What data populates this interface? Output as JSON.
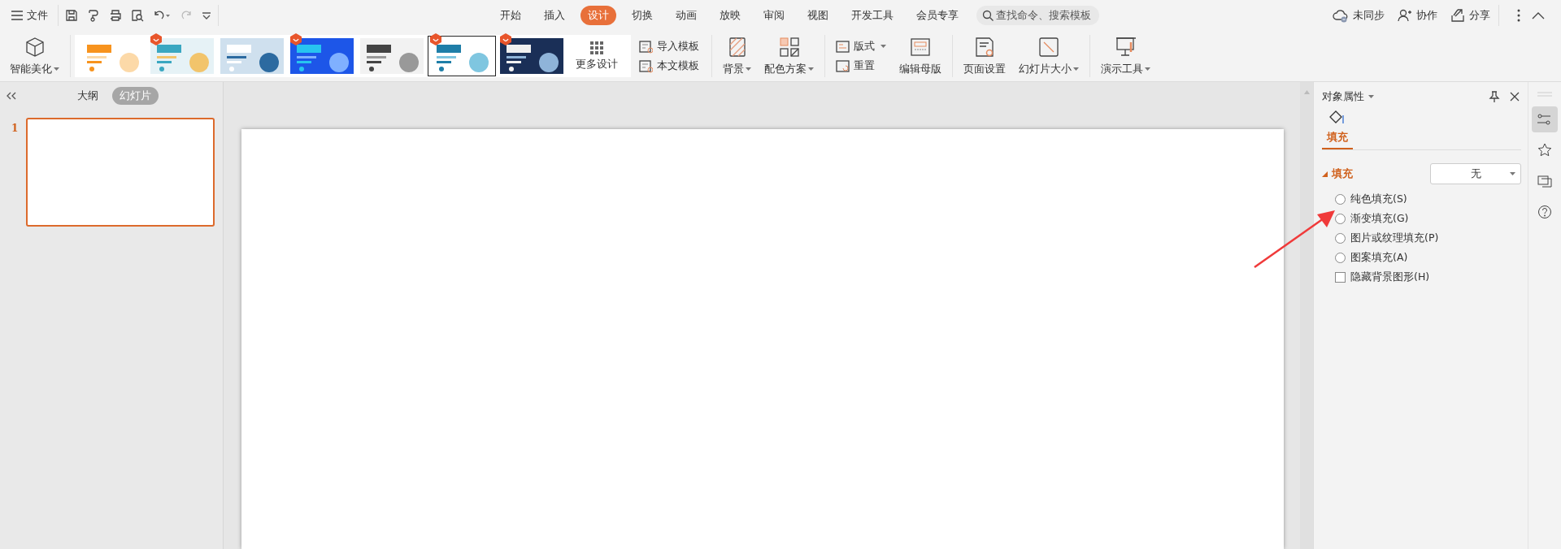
{
  "top_bar": {
    "file_menu": "文件",
    "tabs": [
      {
        "label": "开始",
        "selected": false
      },
      {
        "label": "插入",
        "selected": false
      },
      {
        "label": "设计",
        "selected": true
      },
      {
        "label": "切换",
        "selected": false
      },
      {
        "label": "动画",
        "selected": false
      },
      {
        "label": "放映",
        "selected": false
      },
      {
        "label": "审阅",
        "selected": false
      },
      {
        "label": "视图",
        "selected": false
      },
      {
        "label": "开发工具",
        "selected": false
      },
      {
        "label": "会员专享",
        "selected": false
      }
    ],
    "search": {
      "placeholder": "查找命令、搜索模板"
    },
    "actions": [
      "未同步",
      "协作",
      "分享"
    ]
  },
  "ribbon": {
    "beautify": {
      "label": "智能美化",
      "dropdown": true
    },
    "templates": [
      {
        "badge": false,
        "selected": false
      },
      {
        "badge": true,
        "selected": false
      },
      {
        "badge": false,
        "selected": false
      },
      {
        "badge": true,
        "selected": false
      },
      {
        "badge": false,
        "selected": false
      },
      {
        "badge": true,
        "selected": true
      },
      {
        "badge": true,
        "selected": false
      }
    ],
    "more_designs": "更多设计",
    "template_actions": [
      "导入模板",
      "本文模板"
    ],
    "groups": [
      [
        {
          "kind": "large",
          "label": "背景",
          "dropdown": true
        },
        {
          "kind": "large",
          "label": "配色方案",
          "dropdown": true
        }
      ],
      [
        {
          "kind": "small",
          "label": "版式",
          "dropdown": true
        },
        {
          "kind": "small",
          "label": "重置",
          "dropdown": false
        },
        {
          "kind": "large",
          "label": "编辑母版",
          "dropdown": false
        }
      ],
      [
        {
          "kind": "large",
          "label": "页面设置",
          "dropdown": false
        },
        {
          "kind": "large",
          "label": "幻灯片大小",
          "dropdown": true
        }
      ],
      [
        {
          "kind": "large",
          "label": "演示工具",
          "dropdown": true
        }
      ]
    ]
  },
  "left_panel": {
    "view_tabs": [
      {
        "label": "大纲",
        "selected": false
      },
      {
        "label": "幻灯片",
        "selected": true
      }
    ],
    "slides": [
      {
        "number": "1",
        "selected": true
      }
    ]
  },
  "properties_panel": {
    "title": "对象属性",
    "tabs": [
      {
        "label": "填充",
        "selected": true
      }
    ],
    "section": {
      "label": "填充",
      "expanded": true,
      "fill_type": "无"
    },
    "options": [
      {
        "label": "纯色填充(S)",
        "selected": false
      },
      {
        "label": "渐变填充(G)",
        "selected": false
      },
      {
        "label": "图片或纹理填充(P)",
        "selected": false
      },
      {
        "label": "图案填充(A)",
        "selected": false
      }
    ],
    "hide_background": {
      "label": "隐藏背景图形(H)",
      "checked": false
    },
    "side_tools": [
      {
        "selected": true
      },
      {
        "selected": false
      },
      {
        "selected": false
      },
      {
        "selected": false
      }
    ]
  }
}
